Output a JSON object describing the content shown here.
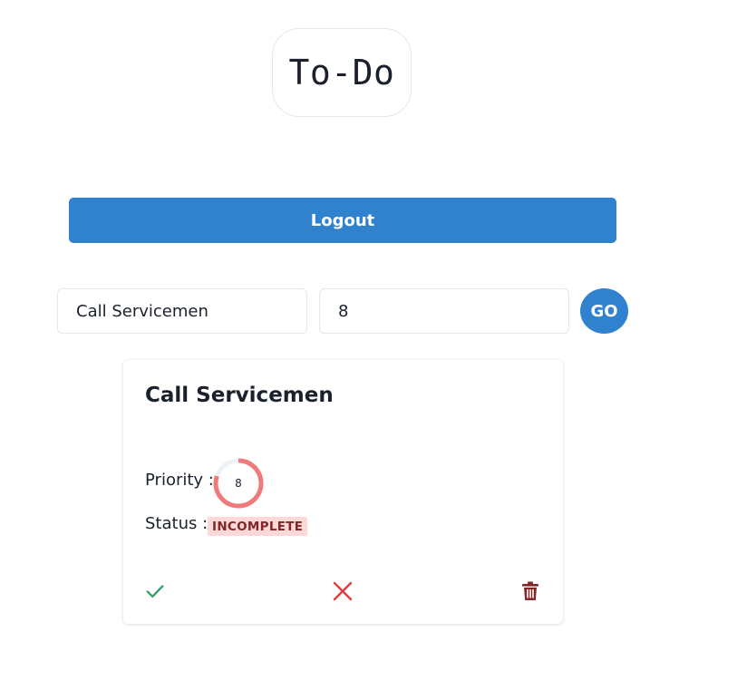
{
  "header": {
    "title": "To-Do"
  },
  "auth": {
    "logout_label": "Logout"
  },
  "form": {
    "title_value": "Call Servicemen",
    "priority_value": "8",
    "submit_label": "GO"
  },
  "todos": [
    {
      "title": "Call Servicemen",
      "priority_label": "Priority :",
      "priority_value": "8",
      "priority_fraction": 0.8,
      "status_label": "Status :",
      "status_value": "INCOMPLETE",
      "actions": {
        "complete_icon": "check-icon",
        "cancel_icon": "close-icon",
        "delete_icon": "trash-icon"
      }
    }
  ],
  "colors": {
    "primary": "#3182ce",
    "ring": "#f07a7a",
    "ring_track": "#edf2f7",
    "badge_bg": "#fed7d7",
    "badge_text": "#822727",
    "check": "#38a169",
    "close": "#e53e3e",
    "trash": "#822727"
  }
}
